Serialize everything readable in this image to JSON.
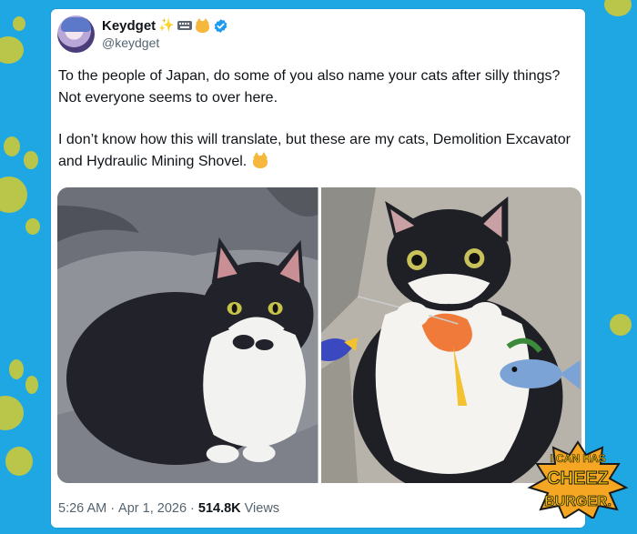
{
  "tweet": {
    "display_name": "Keydget",
    "name_emojis": [
      "sparkles-icon",
      "keyboard-icon",
      "cat-face-icon"
    ],
    "handle": "@keydget",
    "paragraphs": [
      "To the people of Japan, do some of you also name your cats after silly things? Not everyone seems to over here.",
      "I don’t know how this will translate, but these are my cats, Demolition Excavator and Hydraulic Mining Shovel."
    ],
    "time": "5:26 AM",
    "separator": "·",
    "date": "Apr 1, 2026",
    "views_count": "514.8K",
    "views_label": "Views",
    "photos": [
      {
        "subject": "tuxedo cat lying on blanket"
      },
      {
        "subject": "tuxedo cat on back with toys"
      }
    ]
  },
  "watermark": {
    "line1": "I CAN HAS",
    "line2": "CHEEZ",
    "line3": "BURGER."
  },
  "colors": {
    "background": "#1fa7e3",
    "paw": "#b9c64a",
    "verified": "#1d9bf0",
    "text": "#0f1419",
    "muted": "#536471"
  }
}
